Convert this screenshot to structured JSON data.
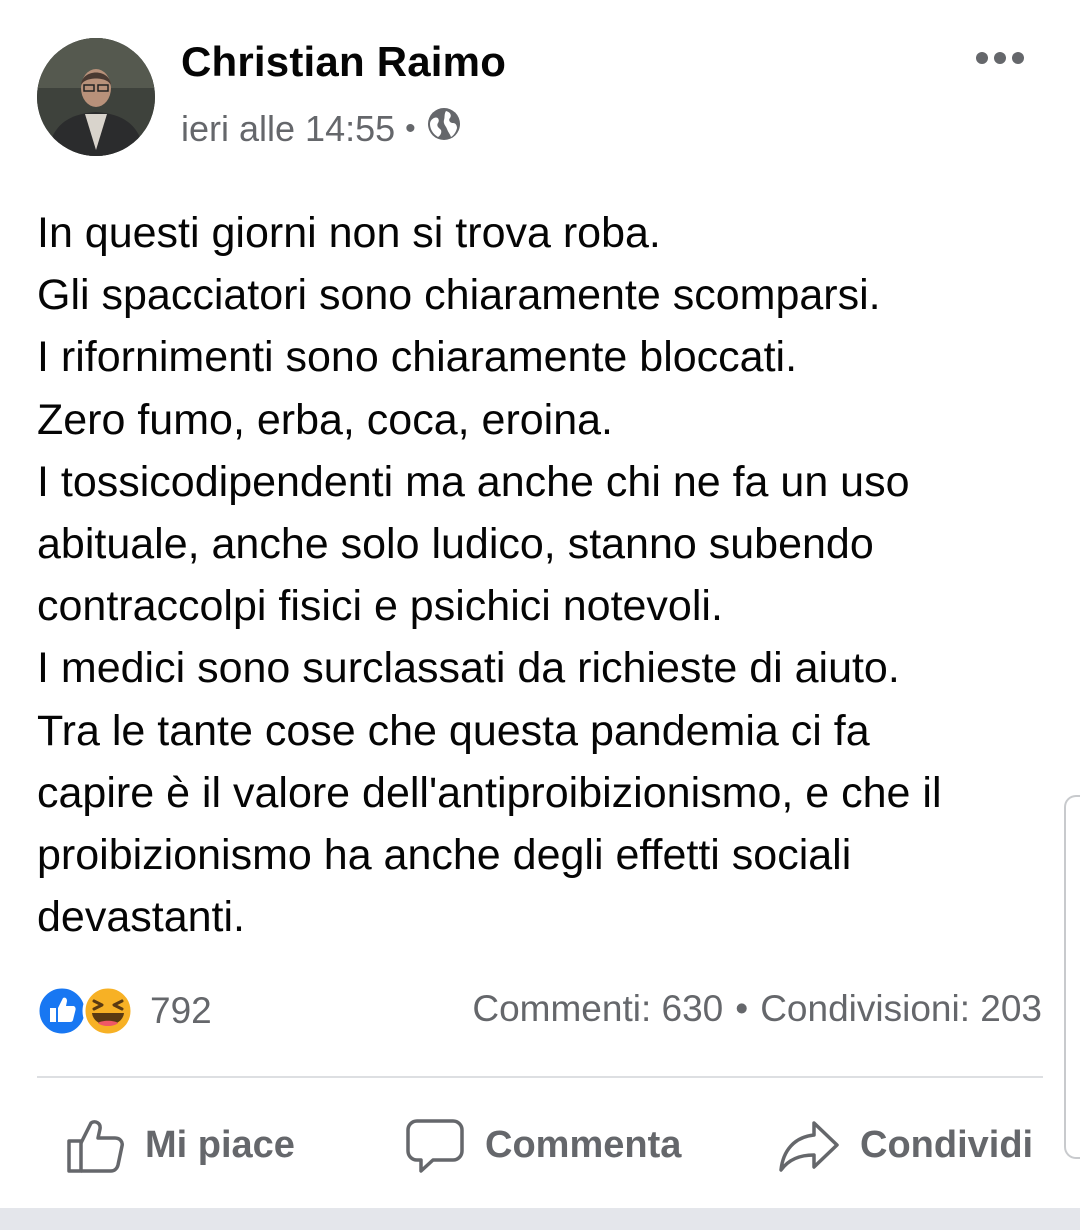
{
  "post": {
    "author": "Christian Raimo",
    "time": "ieri alle 14:55",
    "separator": "•",
    "privacy_icon": "globe-icon",
    "more_icon": "ellipsis-icon",
    "lines": [
      "In questi giorni non si trova roba.",
      "Gli spacciatori sono chiaramente scomparsi.",
      "I rifornimenti sono chiaramente bloccati.",
      "Zero fumo, erba, coca, eroina.",
      "I tossicodipendenti ma anche chi ne fa un uso",
      "abituale, anche solo ludico, stanno subendo",
      "contraccolpi fisici e psichici notevoli.",
      "I medici sono surclassati da richieste di aiuto.",
      "Tra le tante cose che questa pandemia ci fa",
      "capire è il valore dell'antiproibizionismo, e che il",
      "proibizionismo ha anche degli effetti sociali",
      "devastanti."
    ]
  },
  "engagement": {
    "reaction_icons": [
      "like-icon",
      "haha-icon"
    ],
    "reaction_count": "792",
    "comments": "Commenti: 630",
    "stats_separator": "•",
    "shares": "Condivisioni: 203"
  },
  "actions": {
    "like": "Mi piace",
    "comment": "Commenta",
    "share": "Condividi"
  },
  "colors": {
    "secondary_text": "#65676b",
    "like_blue": "#1877f2",
    "haha_yellow": "#f7b125"
  }
}
